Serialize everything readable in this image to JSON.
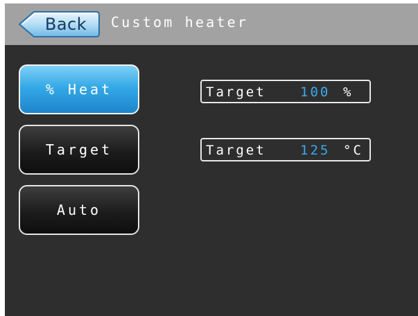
{
  "header": {
    "back_label": "Back",
    "title": "Custom heater"
  },
  "modes": [
    {
      "label": "% Heat",
      "active": true
    },
    {
      "label": "Target",
      "active": false
    },
    {
      "label": "Auto",
      "active": false
    }
  ],
  "readouts": [
    {
      "label": "Target",
      "value": "100",
      "unit": "%"
    },
    {
      "label": "Target",
      "value": "125",
      "unit": "°C"
    }
  ],
  "colors": {
    "title_bar": "#a2a2a2",
    "background": "#2e2e2e",
    "accent": "#35a9e6",
    "value_text": "#3aaaf0"
  }
}
